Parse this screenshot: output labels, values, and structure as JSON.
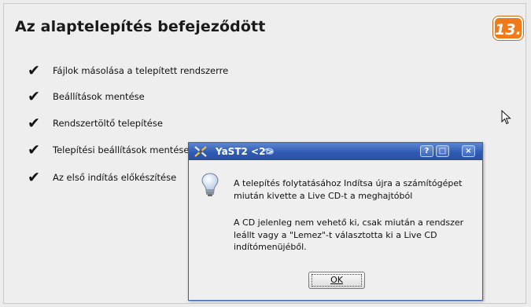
{
  "page": {
    "title": "Az alaptelepítés befejeződött",
    "step_number": "13."
  },
  "steps": [
    {
      "label": "Fájlok másolása a telepített rendszerre",
      "status": "done"
    },
    {
      "label": "Beállítások mentése",
      "status": "done"
    },
    {
      "label": "Rendszertöltő telepítése",
      "status": "done"
    },
    {
      "label": "Telepítési beállítások mentése",
      "status": "done"
    },
    {
      "label": "Az első indítás előkészítése",
      "status": "done"
    }
  ],
  "dialog": {
    "title": "YaST2 <2>",
    "help_label": "?",
    "maximize_label": "□",
    "close_label": "×",
    "message_line1": "A telepítés folytatásához Indítsa újra a számítógépet",
    "message_line2": "miután kivette a Live CD-t a meghajtóból",
    "message_line3": "A CD jelenleg nem vehető ki, csak miután a rendszer",
    "message_line4": "leállt vagy a \"Lemez\"-t választotta ki a Live CD",
    "message_line5": "indítómenüjéből.",
    "ok_label": "OK"
  },
  "colors": {
    "titlebar": "#2f5bb5",
    "badge": "#f07a1a",
    "background": "#eeeeee"
  }
}
